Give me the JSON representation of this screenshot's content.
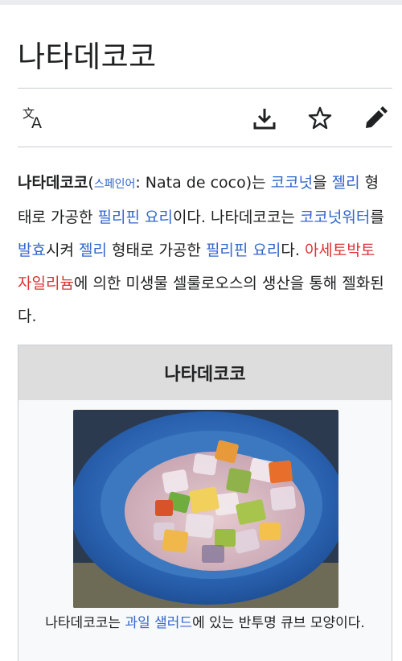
{
  "page": {
    "title": "나타데코코"
  },
  "toolbar": {
    "language_icon": "language-icon",
    "download_icon": "download-icon",
    "star_icon": "star-icon",
    "edit_icon": "pencil-icon"
  },
  "lead": {
    "term": "나타데코코",
    "open_paren": "(",
    "lang_link": "스페인어",
    "colon_text": ": Nata de coco)는 ",
    "link_coconut": "코코넛",
    "t1": "을 ",
    "link_jelly": "젤리",
    "t2": " 형태로 가공한 ",
    "link_ph_food": "필리핀 요리",
    "t3": "이다. 나타데코코는 ",
    "link_coconut_water": "코코넛워터",
    "t4": "를 ",
    "link_fermentation": "발효",
    "t5": "시켜 ",
    "link_jelly2": "젤리",
    "t6": " 형태로 가공한 ",
    "link_ph_food2": "필리핀 요리",
    "t7": "다. ",
    "redlink_bacteria": "아세토박토 자일리늄",
    "t8": "에 의한 미생물 셀룰로오스의 생산을 통해 젤화된다."
  },
  "infobox": {
    "heading": "나타데코코",
    "caption_pre": "나타데코코는 ",
    "caption_link": "과일 샐러드",
    "caption_post": "에 있는 반투명 큐브 모양이다."
  },
  "colors": {
    "link": "#3366cc",
    "redlink": "#dd3333",
    "text": "#202122",
    "infobox_header": "#dddddd"
  }
}
